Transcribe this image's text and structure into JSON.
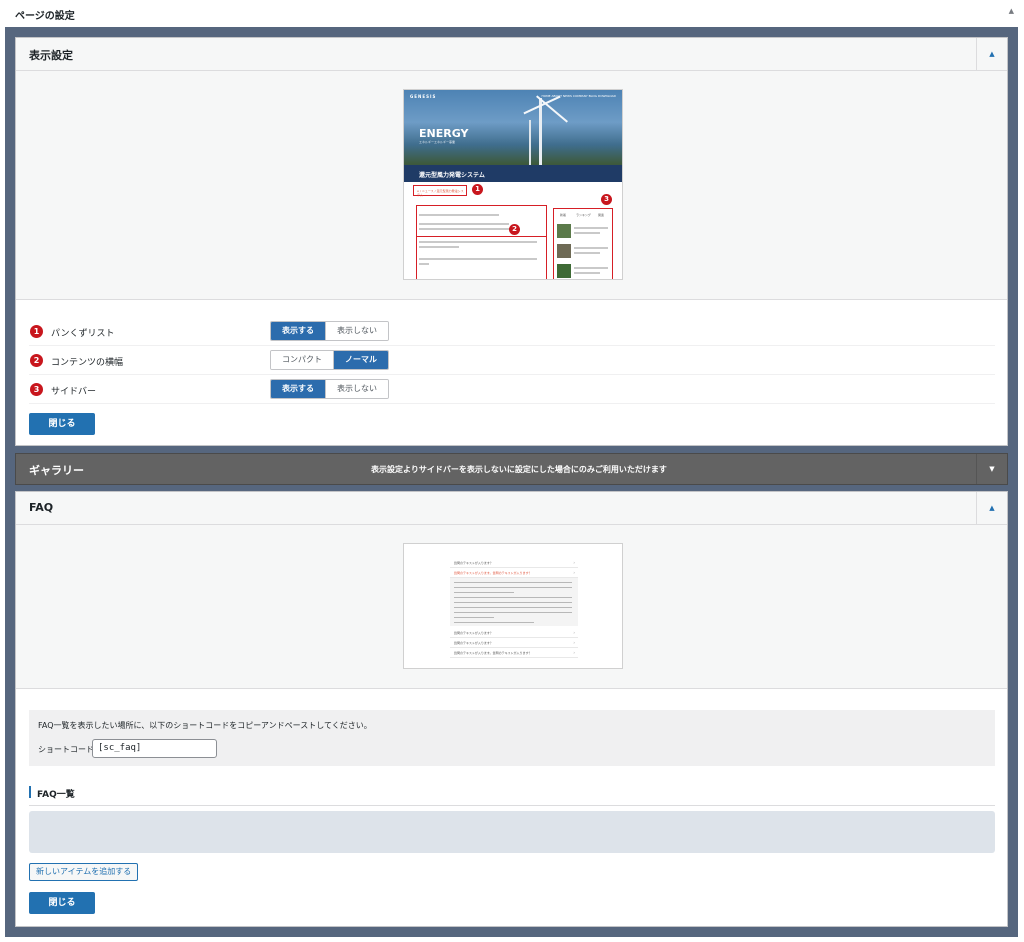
{
  "page": {
    "title": "ページの設定"
  },
  "display_panel": {
    "title": "表示設定",
    "preview": {
      "logo": "GENESIS",
      "nav": "HOME   ABOUT   NEWS         COMPANY   BLOG   DOWNLOAD",
      "hero_word": "ENERGY",
      "hero_sub": "エネルギーエネルギー事業",
      "band_title": "還元型風力発電システム",
      "crumb": "⌂  /  ニュース  /  還元型風力発電システム",
      "sidebar_tabs": [
        "新着",
        "ランキング",
        "関連"
      ],
      "markers": [
        "1",
        "2",
        "3"
      ]
    },
    "settings": [
      {
        "num": "1",
        "label": "パンくずリスト",
        "options": [
          "表示する",
          "表示しない"
        ],
        "selected": "表示する"
      },
      {
        "num": "2",
        "label": "コンテンツの横幅",
        "options": [
          "コンパクト",
          "ノーマル"
        ],
        "selected": "ノーマル"
      },
      {
        "num": "3",
        "label": "サイドバー",
        "options": [
          "表示する",
          "表示しない"
        ],
        "selected": "表示する"
      }
    ],
    "close_label": "閉じる"
  },
  "gallery_panel": {
    "title": "ギャラリー",
    "message": "表示設定よりサイドバーを表示しないに設定にした場合にのみご利用いただけます"
  },
  "faq_panel": {
    "title": "FAQ",
    "preview": {
      "questions": [
        "質問のテキストが入ります？",
        "質問のテキストが入ります。質問のテキストが入ります？",
        "質問のテキストが入ります？",
        "質問のテキストが入ります？",
        "質問のテキストが入ります。質問のテキストが入ります？"
      ]
    },
    "instruction": "FAQ一覧を表示したい場所に、以下のショートコードをコピーアンドペーストしてください。",
    "shortcode_label": "ショートコード：",
    "shortcode_value": "[sc_faq]",
    "list_title": "FAQ一覧",
    "add_item_label": "新しいアイテムを追加する",
    "close_label": "閉じる"
  },
  "colors": {
    "frame": "#56667e",
    "accent": "#2271b1",
    "selected": "#2c6cad",
    "marker": "#c8161d",
    "gallery": "#636363"
  },
  "icons": {
    "collapse": "triangle-up-icon",
    "expand": "triangle-down-icon"
  }
}
